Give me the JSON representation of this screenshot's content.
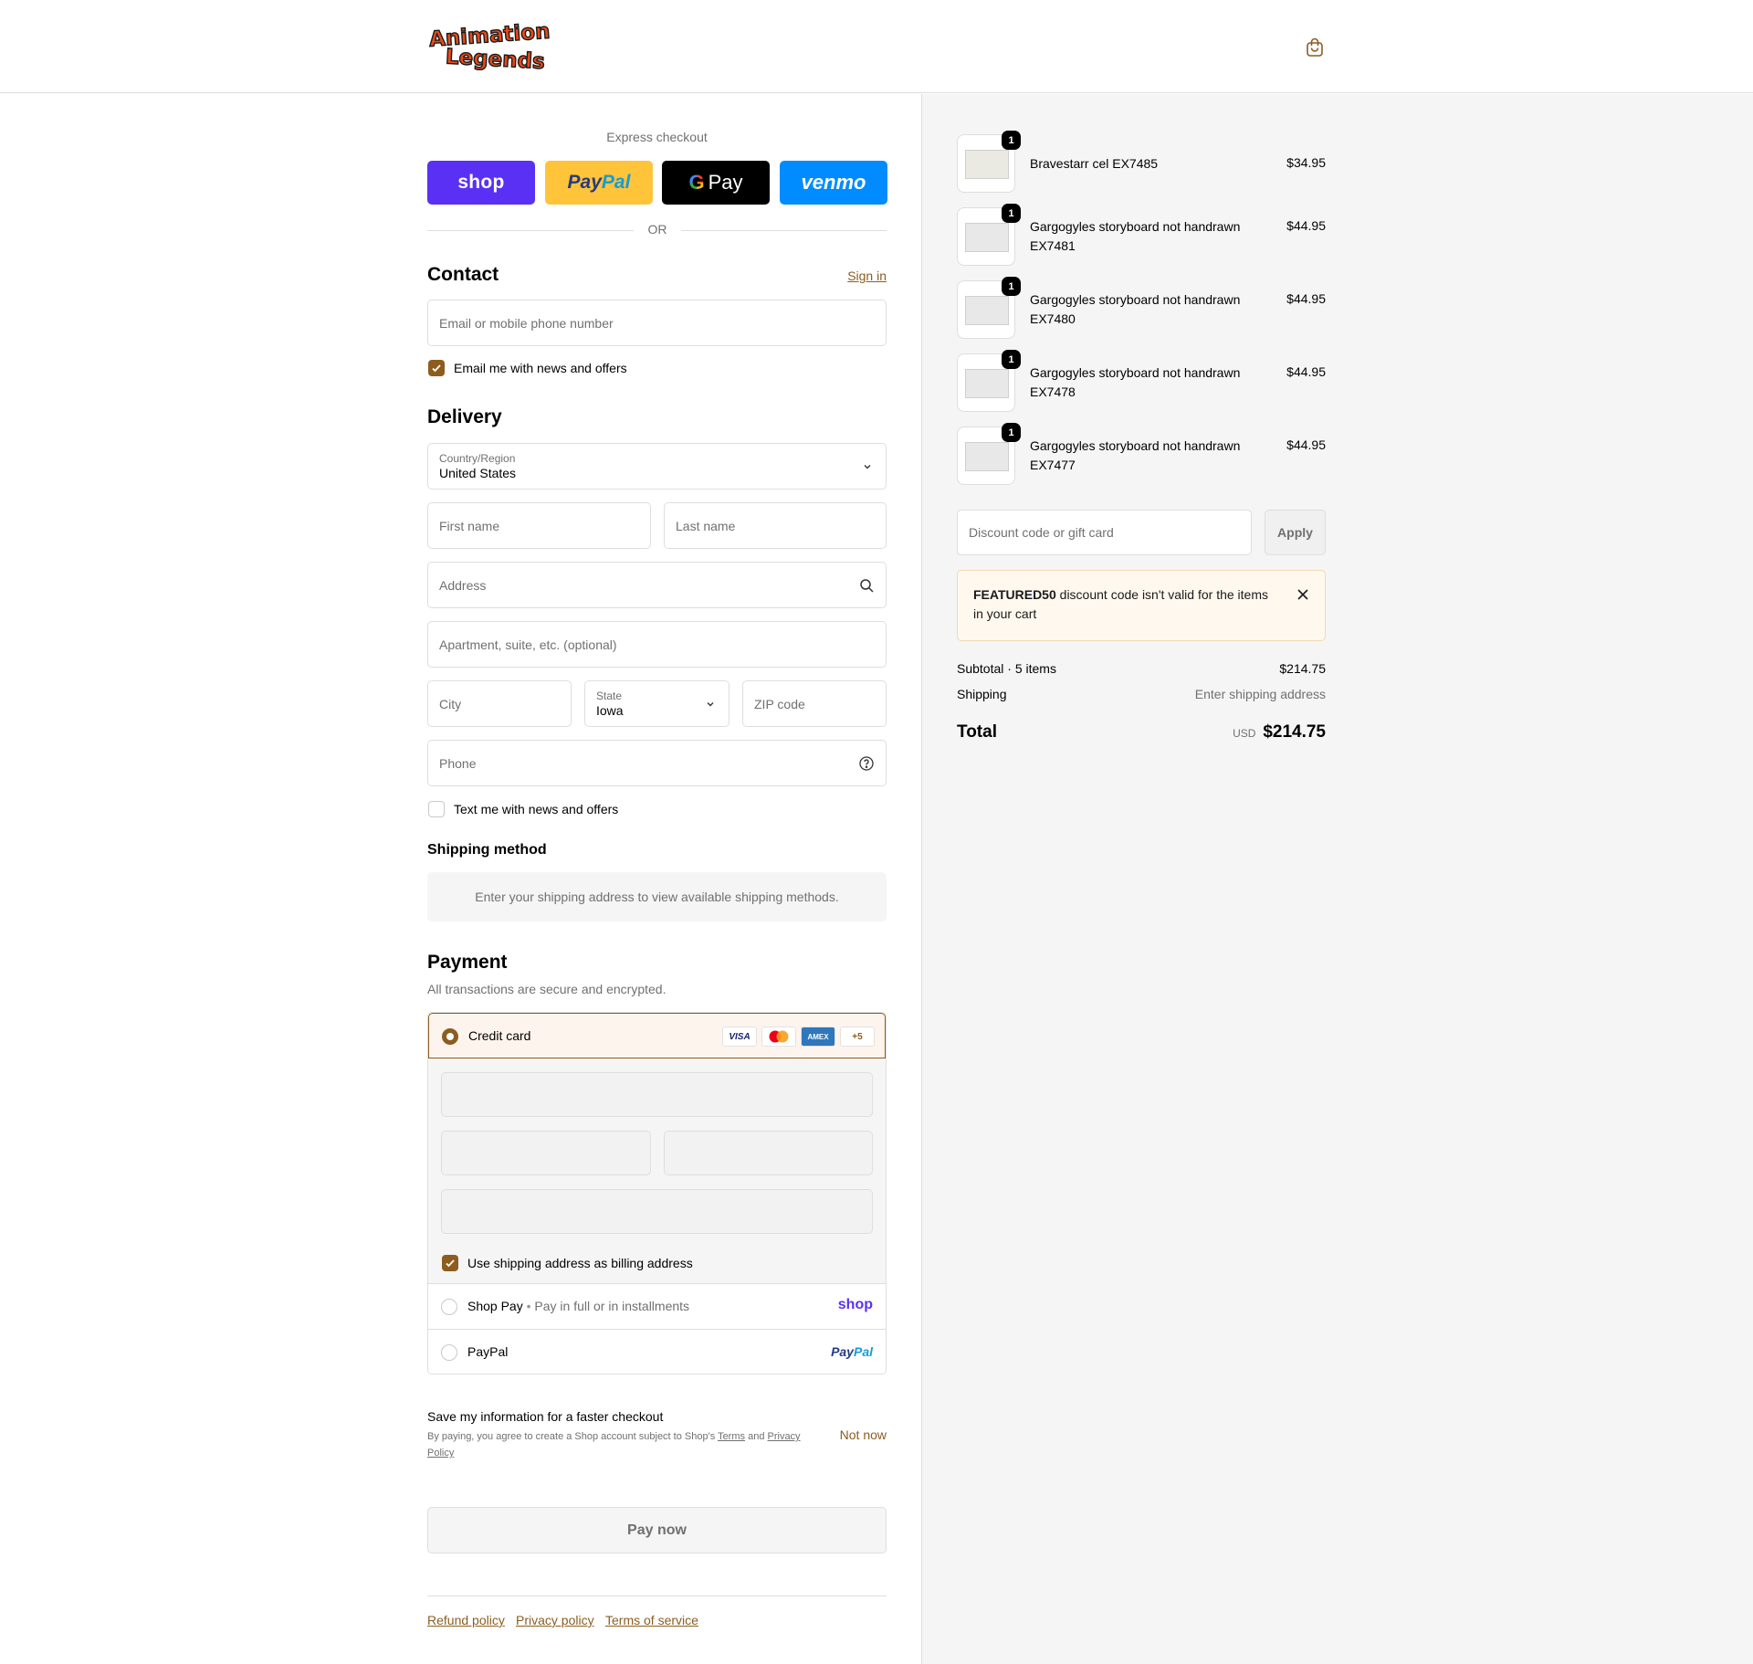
{
  "header": {
    "logo_text": "Animation Legends",
    "cart_icon": "shopping-bag-icon"
  },
  "express": {
    "title": "Express checkout",
    "shop": "shop",
    "paypal_a": "Pay",
    "paypal_b": "Pal",
    "gpay_g": "G",
    "gpay": "Pay",
    "venmo": "venmo",
    "or": "OR"
  },
  "contact": {
    "heading": "Contact",
    "sign_in": "Sign in",
    "email_placeholder": "Email or mobile phone number",
    "email_news": "Email me with news and offers"
  },
  "delivery": {
    "heading": "Delivery",
    "country_label": "Country/Region",
    "country_value": "United States",
    "first_name": "First name",
    "last_name": "Last name",
    "address": "Address",
    "apartment": "Apartment, suite, etc. (optional)",
    "city": "City",
    "state_label": "State",
    "state_value": "Iowa",
    "zip": "ZIP code",
    "phone": "Phone",
    "text_news": "Text me with news and offers"
  },
  "shipping_method": {
    "heading": "Shipping method",
    "message": "Enter your shipping address to view available shipping methods."
  },
  "payment": {
    "heading": "Payment",
    "subtitle": "All transactions are secure and encrypted.",
    "credit_card": "Credit card",
    "cards": [
      "VISA",
      "MC",
      "AMEX",
      "+5"
    ],
    "billing_same": "Use shipping address as billing address",
    "shop_pay": "Shop Pay",
    "shop_pay_sub": "Pay in full or in installments",
    "shop_logo": "shop",
    "paypal": "PayPal",
    "paypal_logo_a": "Pay",
    "paypal_logo_b": "Pal"
  },
  "save_info": {
    "title": "Save my information for a faster checkout",
    "text_a": "By paying, you agree to create a Shop account subject to Shop's",
    "terms": "Terms",
    "and": "and",
    "privacy": "Privacy Policy",
    "not_now": "Not now"
  },
  "pay_now": "Pay now",
  "footer": {
    "refund": "Refund policy",
    "privacy": "Privacy policy",
    "terms": "Terms of service"
  },
  "cart": {
    "items": [
      {
        "name": "Bravestarr cel EX7485",
        "price": "$34.95",
        "qty": "1"
      },
      {
        "name": "Gargogyles storyboard not handrawn EX7481",
        "price": "$44.95",
        "qty": "1"
      },
      {
        "name": "Gargogyles storyboard not handrawn EX7480",
        "price": "$44.95",
        "qty": "1"
      },
      {
        "name": "Gargogyles storyboard not handrawn EX7478",
        "price": "$44.95",
        "qty": "1"
      },
      {
        "name": "Gargogyles storyboard not handrawn EX7477",
        "price": "$44.95",
        "qty": "1"
      }
    ],
    "discount_placeholder": "Discount code or gift card",
    "apply": "Apply",
    "alert_code": "FEATURED50",
    "alert_text": "discount code isn't valid for the items in your cart",
    "subtotal_label": "Subtotal · 5 items",
    "subtotal_value": "$214.75",
    "shipping_label": "Shipping",
    "shipping_value": "Enter shipping address",
    "total_label": "Total",
    "currency": "USD",
    "total_value": "$214.75"
  },
  "colors": {
    "accent": "#8c5d1f",
    "shop": "#5a31f4",
    "paypal": "#ffc439",
    "venmo": "#008cff"
  }
}
